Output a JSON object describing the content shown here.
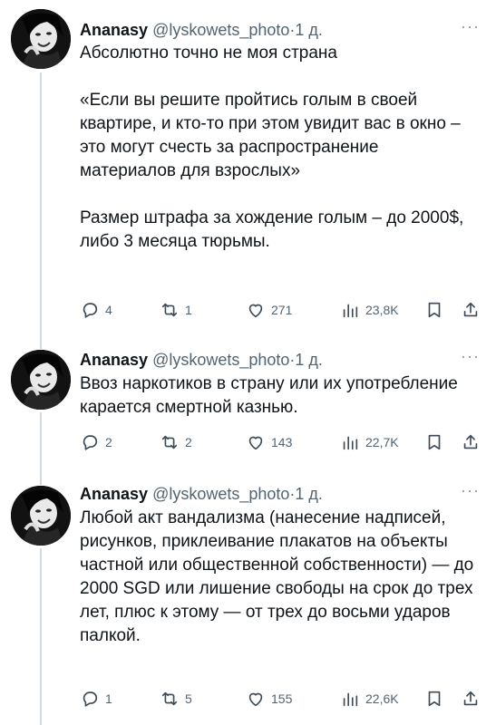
{
  "tweets": [
    {
      "author_name": "Ananasy",
      "handle": "@lyskowets_photo",
      "separator": "·",
      "time": "1 д.",
      "more": "···",
      "text": "Абсолютно точно не моя страна\n\n«Если вы решите пройтись голым в своей квартире, и кто-то при этом увидит вас в окно – это могут счесть за распространение материалов для взрослых»\n\nРазмер штрафа за хождение голым – до 2000$, либо 3 месяца тюрьмы.",
      "replies": "4",
      "reposts": "1",
      "likes": "271",
      "views": "23,8K"
    },
    {
      "author_name": "Ananasy",
      "handle": "@lyskowets_photo",
      "separator": "·",
      "time": "1 д.",
      "more": "···",
      "text": "Ввоз наркотиков в страну или их употребление карается смертной казнью.",
      "replies": "2",
      "reposts": "2",
      "likes": "143",
      "views": "22,7K"
    },
    {
      "author_name": "Ananasy",
      "handle": "@lyskowets_photo",
      "separator": "·",
      "time": "1 д.",
      "more": "···",
      "text": "Любой акт вандализма (нанесение надписей, рисунков, приклеивание плакатов на объекты частной или общественной собственности) — до 2000 SGD или лишение свободы на срок до трех лет, плюс к этому — от трех до восьми ударов палкой.",
      "replies": "1",
      "reposts": "5",
      "likes": "155",
      "views": "22,6K"
    }
  ]
}
